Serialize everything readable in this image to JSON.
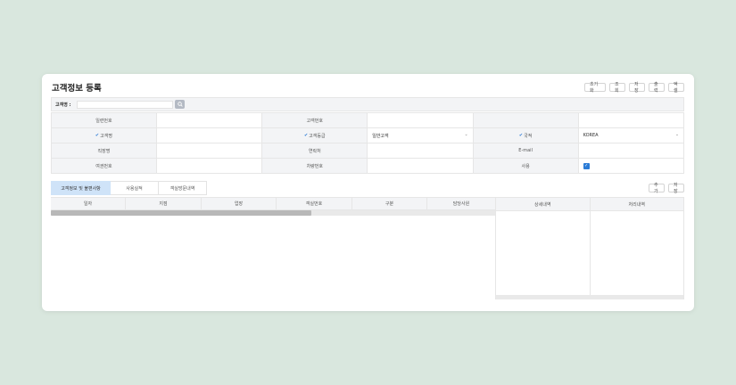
{
  "page": {
    "title": "고객정보 등록"
  },
  "toolbar": [
    "초기화",
    "조회",
    "저장",
    "출력",
    "엑셀"
  ],
  "search": {
    "label": "고객명 :",
    "value": "",
    "icon": "search-icon"
  },
  "form": {
    "rows": [
      [
        {
          "label": "일련번호",
          "required": false,
          "value": ""
        },
        {
          "label": "고객번호",
          "required": false,
          "value": ""
        },
        {
          "label": "",
          "required": false,
          "value": ""
        }
      ],
      [
        {
          "label": "고객명",
          "required": true,
          "value": ""
        },
        {
          "label": "고객등급",
          "required": true,
          "value": "일반고객",
          "type": "select"
        },
        {
          "label": "국적",
          "required": true,
          "value": "KOREA",
          "type": "select"
        }
      ],
      [
        {
          "label": "직장명",
          "required": false,
          "value": ""
        },
        {
          "label": "연락처",
          "required": false,
          "value": ""
        },
        {
          "label": "E-mail",
          "required": false,
          "value": ""
        }
      ],
      [
        {
          "label": "여권번호",
          "required": false,
          "value": ""
        },
        {
          "label": "차량번호",
          "required": false,
          "value": ""
        },
        {
          "label": "사용",
          "required": false,
          "value": "",
          "type": "checkbox",
          "checked": true
        }
      ]
    ]
  },
  "tabs": [
    {
      "label": "고객정보 및 불편사항",
      "active": true
    },
    {
      "label": "사용실적",
      "active": false
    },
    {
      "label": "객실방문내역",
      "active": false
    }
  ],
  "lower_buttons": [
    "추가",
    "저장"
  ],
  "table": {
    "columns": [
      "일자",
      "지점",
      "업장",
      "객실번호",
      "구분",
      "담당사원"
    ]
  },
  "detail": {
    "columns": [
      "상세내역",
      "처리내역"
    ]
  },
  "colors": {
    "accent": "#2b7bd6",
    "tab_active": "#cfe3f8",
    "background": "#d9e7de"
  }
}
